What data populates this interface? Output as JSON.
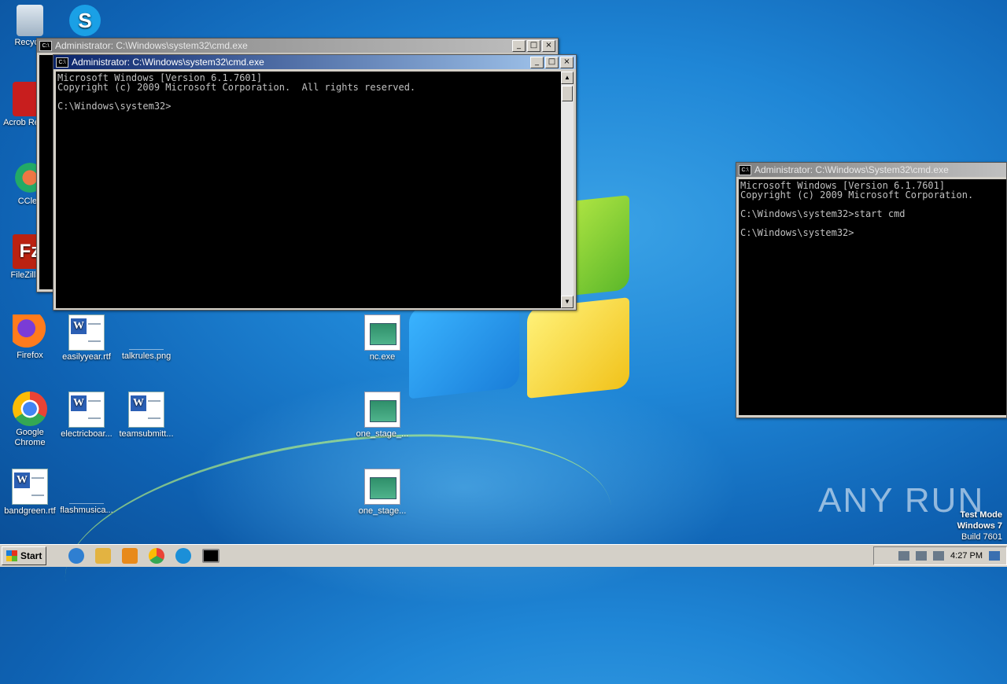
{
  "desktop_icons": [
    {
      "name": "recycle-bin",
      "label": "Recycle"
    },
    {
      "name": "acrobat-reader",
      "label": "Acrob Reader"
    },
    {
      "name": "ccleaner",
      "label": "CClea"
    },
    {
      "name": "filezilla",
      "label": "FileZilla C"
    },
    {
      "name": "firefox",
      "label": "Firefox"
    },
    {
      "name": "google-chrome",
      "label": "Google Chrome"
    },
    {
      "name": "bandgreen",
      "label": "bandgreen.rtf"
    },
    {
      "name": "easilyyear",
      "label": "easilyyear.rtf"
    },
    {
      "name": "electricboar",
      "label": "electricboar..."
    },
    {
      "name": "flashmusica",
      "label": "flashmusica..."
    },
    {
      "name": "talkrules",
      "label": "talkrules.png"
    },
    {
      "name": "teamsubmitt",
      "label": "teamsubmitt..."
    },
    {
      "name": "nc-exe",
      "label": "nc.exe"
    },
    {
      "name": "one-stage-1",
      "label": "one_stage_..."
    },
    {
      "name": "one-stage-2",
      "label": "one_stage..."
    }
  ],
  "windows": {
    "back": {
      "title": "Administrator: C:\\Windows\\system32\\cmd.exe"
    },
    "front": {
      "title": "Administrator: C:\\Windows\\system32\\cmd.exe",
      "console": "Microsoft Windows [Version 6.1.7601]\nCopyright (c) 2009 Microsoft Corporation.  All rights reserved.\n\nC:\\Windows\\system32>"
    },
    "right": {
      "title": "Administrator: C:\\Windows\\System32\\cmd.exe",
      "console": "Microsoft Windows [Version 6.1.7601]\nCopyright (c) 2009 Microsoft Corporation.\n\nC:\\Windows\\system32>start cmd\n\nC:\\Windows\\system32>"
    }
  },
  "watermark": "ANY RUN",
  "test_mode": {
    "line1": "Test Mode",
    "line2": "Windows 7",
    "line3": "Build 7601"
  },
  "taskbar": {
    "start_label": "Start",
    "clock": "4:27 PM"
  }
}
